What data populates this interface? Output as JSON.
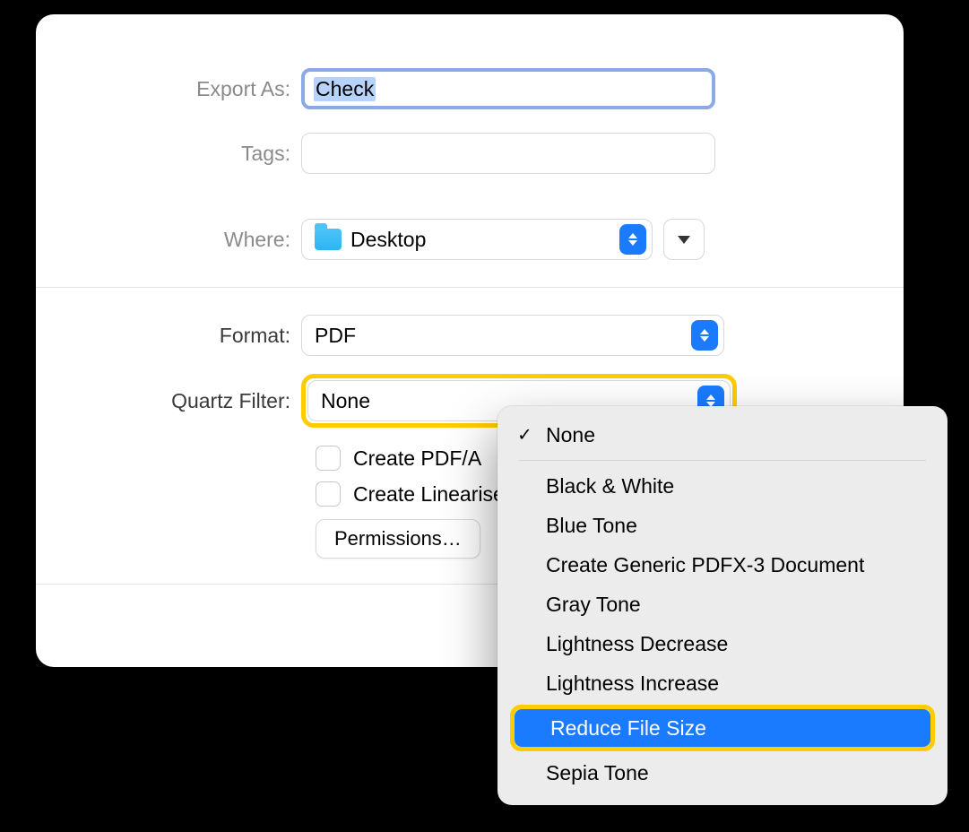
{
  "labels": {
    "export_as": "Export As:",
    "tags": "Tags:",
    "where": "Where:",
    "format": "Format:",
    "quartz_filter": "Quartz Filter:"
  },
  "values": {
    "export_as": "Check",
    "tags": "",
    "where": "Desktop",
    "format": "PDF",
    "quartz_filter": "None"
  },
  "options": {
    "create_pdfa": "Create PDF/A",
    "create_linearised": "Create Linearise",
    "permissions": "Permissions…"
  },
  "menu": {
    "selected": "None",
    "highlighted": "Reduce File Size",
    "items_top": [
      "None"
    ],
    "items": [
      "Black & White",
      "Blue Tone",
      "Create Generic PDFX-3 Document",
      "Gray Tone",
      "Lightness Decrease",
      "Lightness Increase",
      "Reduce File Size",
      "Sepia Tone"
    ]
  }
}
